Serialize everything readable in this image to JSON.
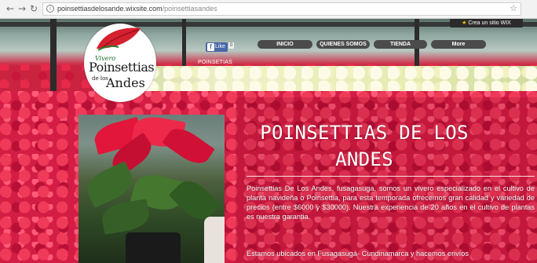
{
  "browser": {
    "back_icon": "arrow-left-icon",
    "forward_icon": "arrow-right-icon",
    "reload_icon": "reload-icon",
    "url_domain": "poinsettiasdelosande.wixsite.com",
    "url_path": "/poinsettiasandes",
    "bookmark_icon": "star-icon"
  },
  "wix_banner": {
    "label": "Crea un sitio WIX"
  },
  "facebook": {
    "like_label": "Like",
    "count": "0"
  },
  "logo": {
    "line1": "Vivero",
    "line2": "Poinsettias",
    "line3": "de los",
    "line4": "Andes"
  },
  "site_subtitle": "POINSETIAS",
  "menu": {
    "items": [
      {
        "label": "INICIO"
      },
      {
        "label": "QUIENES SOMOS"
      },
      {
        "label": "TIENDA"
      },
      {
        "label": "More"
      }
    ]
  },
  "hero": {
    "title": "POINSETTIAS DE LOS ANDES",
    "paragraph1": "Poinsettias De Los Andes, fusagasuga, somos un vivero especializado en el cultivo de planta navideña o Poinsettia, para esta temporada ofrecemos gran calidad y variedad de precios (entre $6000 y $30000). Nuestra experiencia de 20 años en el cultivo de plantas es nuestra garantia.",
    "paragraph2": "Estamos ubicados en Fusagasugá- Cundinamarca y hacemos envíos"
  },
  "colors": {
    "menu_bg": "#4b4b4b",
    "poinsettia_red": "#d41d44",
    "wix_bar": "#2b2b2b",
    "facebook_blue": "#4a67a8"
  }
}
